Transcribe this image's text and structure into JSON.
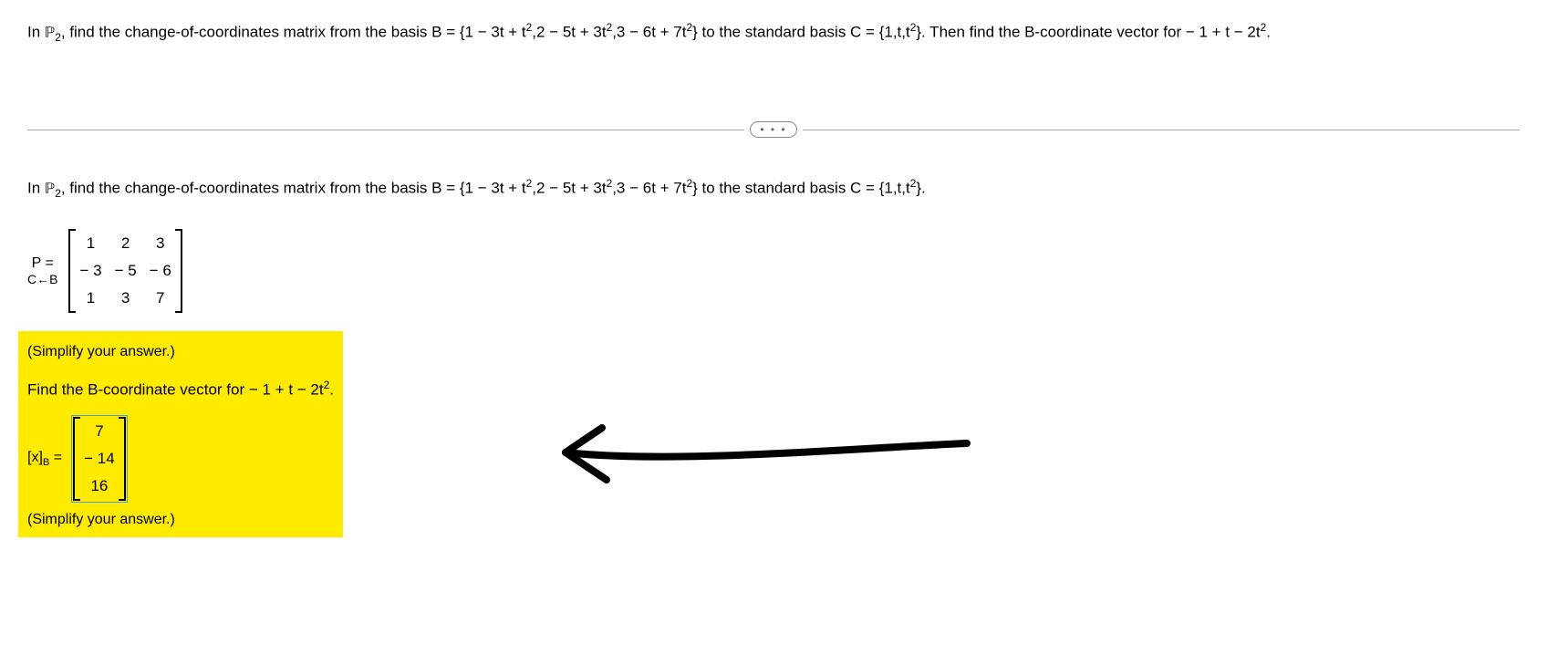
{
  "question_top": {
    "prefix": "In ",
    "space": "ℙ",
    "space_sub": "2",
    "after_sub": ", find the change-of-coordinates matrix from the basis B = ",
    "basis_B": "{1 − 3t + t",
    "sup1": "2",
    "basis_B2": ",2 − 5t + 3t",
    "sup2": "2",
    "basis_B3": ",3 − 6t + 7t",
    "sup3": "2",
    "basis_B4": "}",
    "to_std": " to the standard basis C = ",
    "basis_C": "{1,t,t",
    "supC": "2",
    "basis_C2": "}",
    "then": ". Then find the B-coordinate vector for  − 1 + t − 2t",
    "supT": "2",
    "end": "."
  },
  "divider_label": "• • •",
  "question_mid": {
    "prefix": "In ",
    "space": "ℙ",
    "space_sub": "2",
    "after_sub": ", find the change-of-coordinates matrix from the basis B = ",
    "basis_B": "{1 − 3t + t",
    "sup1": "2",
    "basis_B2": ",2 − 5t + 3t",
    "sup2": "2",
    "basis_B3": ",3 − 6t + 7t",
    "sup3": "2",
    "basis_B4": "}",
    "to_std": " to the standard basis C = ",
    "basis_C": "{1,t,t",
    "supC": "2",
    "basis_C2": "}",
    "end": "."
  },
  "p_label_top": "P   =",
  "p_label_bottom": "C←B",
  "p_matrix": {
    "r1": [
      "1",
      "2",
      "3"
    ],
    "r2": [
      "− 3",
      "− 5",
      "− 6"
    ],
    "r3": [
      "1",
      "3",
      "7"
    ]
  },
  "simplify": "(Simplify your answer.)",
  "find_b": {
    "text": "Find the B-coordinate vector for  − 1 + t − 2t",
    "sup": "2",
    "end": "."
  },
  "xb_label_pre": "[x]",
  "xb_label_sub": "B",
  "xb_label_post": " = ",
  "x_vector": [
    "7",
    "− 14",
    "16"
  ],
  "chart_data": {
    "type": "table",
    "title": "Change-of-coordinates problem in P2",
    "basis_B_polynomials": [
      "1 - 3t + t^2",
      "2 - 5t + 3t^2",
      "3 - 6t + 7t^2"
    ],
    "standard_basis_C": [
      "1",
      "t",
      "t^2"
    ],
    "target_polynomial": "-1 + t - 2t^2",
    "P_CfromB_matrix": [
      [
        1,
        2,
        3
      ],
      [
        -3,
        -5,
        -6
      ],
      [
        1,
        3,
        7
      ]
    ],
    "x_B_coordinate_vector": [
      7,
      -14,
      16
    ]
  }
}
